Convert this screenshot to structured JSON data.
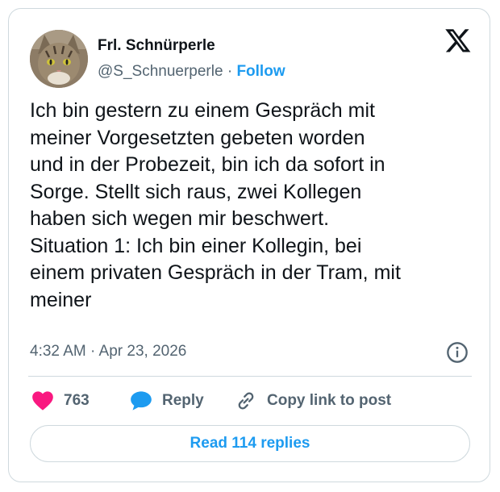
{
  "author": {
    "display_name": "Frl. Schnürperle",
    "handle": "@S_Schnuerperle",
    "separator": " · ",
    "follow_label": "Follow",
    "avatar_icon": "cat-avatar"
  },
  "tweet": {
    "text": "Ich bin gestern zu einem Gespräch mit\nmeiner Vorgesetzten gebeten worden\nund in der Probezeit, bin ich da sofort in\nSorge. Stellt sich raus, zwei Kollegen\nhaben sich wegen mir beschwert.\nSituation 1: Ich bin einer Kollegin, bei\neinem privaten Gespräch in der Tram, mit\nmeiner",
    "timestamp": "4:32 AM · Apr 23, 2026"
  },
  "actions": {
    "like_count": "763",
    "reply_label": "Reply",
    "copy_link_label": "Copy link to post",
    "read_replies_label": "Read 114 replies"
  },
  "icons": [
    "x-logo-icon",
    "info-icon",
    "heart-icon",
    "reply-bubble-icon",
    "link-icon"
  ],
  "colors": {
    "accent": "#1d9bf0",
    "like": "#f91880",
    "text": "#0f1419",
    "muted": "#536471",
    "border": "#cfd9de"
  }
}
